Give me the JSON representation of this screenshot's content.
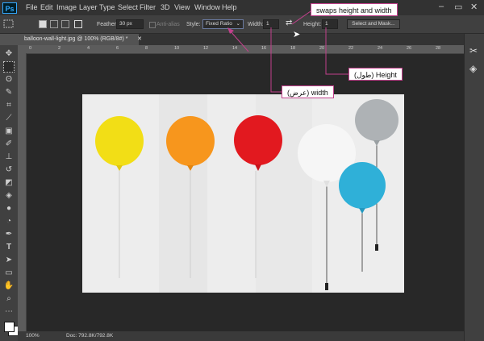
{
  "app": {
    "logo": "Ps"
  },
  "menu": [
    "File",
    "Edit",
    "Image",
    "Layer",
    "Type",
    "Select",
    "Filter",
    "3D",
    "View",
    "Window",
    "Help"
  ],
  "options": {
    "feather_label": "Feather:",
    "feather_value": "30 px",
    "antialias_label": "Anti-alias",
    "style_label": "Style:",
    "style_value": "Fixed Ratio",
    "width_label": "Width:",
    "width_value": "1",
    "height_label": "Height:",
    "height_value": "1",
    "select_mask_label": "Select and Mask..."
  },
  "document": {
    "tab_title": "balloon-wall-light.jpg @ 100% (RGB/8#) *",
    "zoom": "100%",
    "doc_size": "Doc: 792.8K/792.8K"
  },
  "ruler": {
    "ticks": [
      "0",
      "2",
      "4",
      "6",
      "8",
      "10",
      "12",
      "14",
      "16",
      "18",
      "20",
      "22",
      "24",
      "26",
      "28"
    ]
  },
  "annotations": {
    "swap": "swaps height and width",
    "height": "(طول) Height",
    "width": "(عرض) width"
  },
  "colors": {
    "annotation_line": "#c2408c",
    "photo_bg": "#ededed",
    "balloons": [
      "#f2de16",
      "#f7961d",
      "#e2191f",
      "#eeeeee",
      "#aeb2b5",
      "#2fb0d8"
    ]
  }
}
